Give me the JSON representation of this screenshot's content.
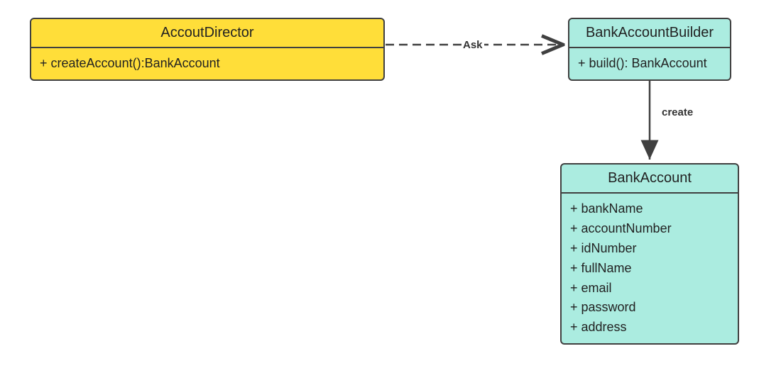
{
  "classes": {
    "director": {
      "name": "AccoutDirector",
      "methods": [
        "+ createAccount():BankAccount"
      ]
    },
    "builder": {
      "name": "BankAccountBuilder",
      "methods": [
        "+ build(): BankAccount"
      ]
    },
    "account": {
      "name": "BankAccount",
      "attributes": [
        "+ bankName",
        "+ accountNumber",
        "+ idNumber",
        "+ fullName",
        "+ email",
        "+ password",
        "+ address"
      ]
    }
  },
  "relations": {
    "ask": "Ask",
    "create": "create"
  },
  "colors": {
    "yellow": "#ffde39",
    "teal": "#abece0",
    "stroke": "#404040"
  }
}
